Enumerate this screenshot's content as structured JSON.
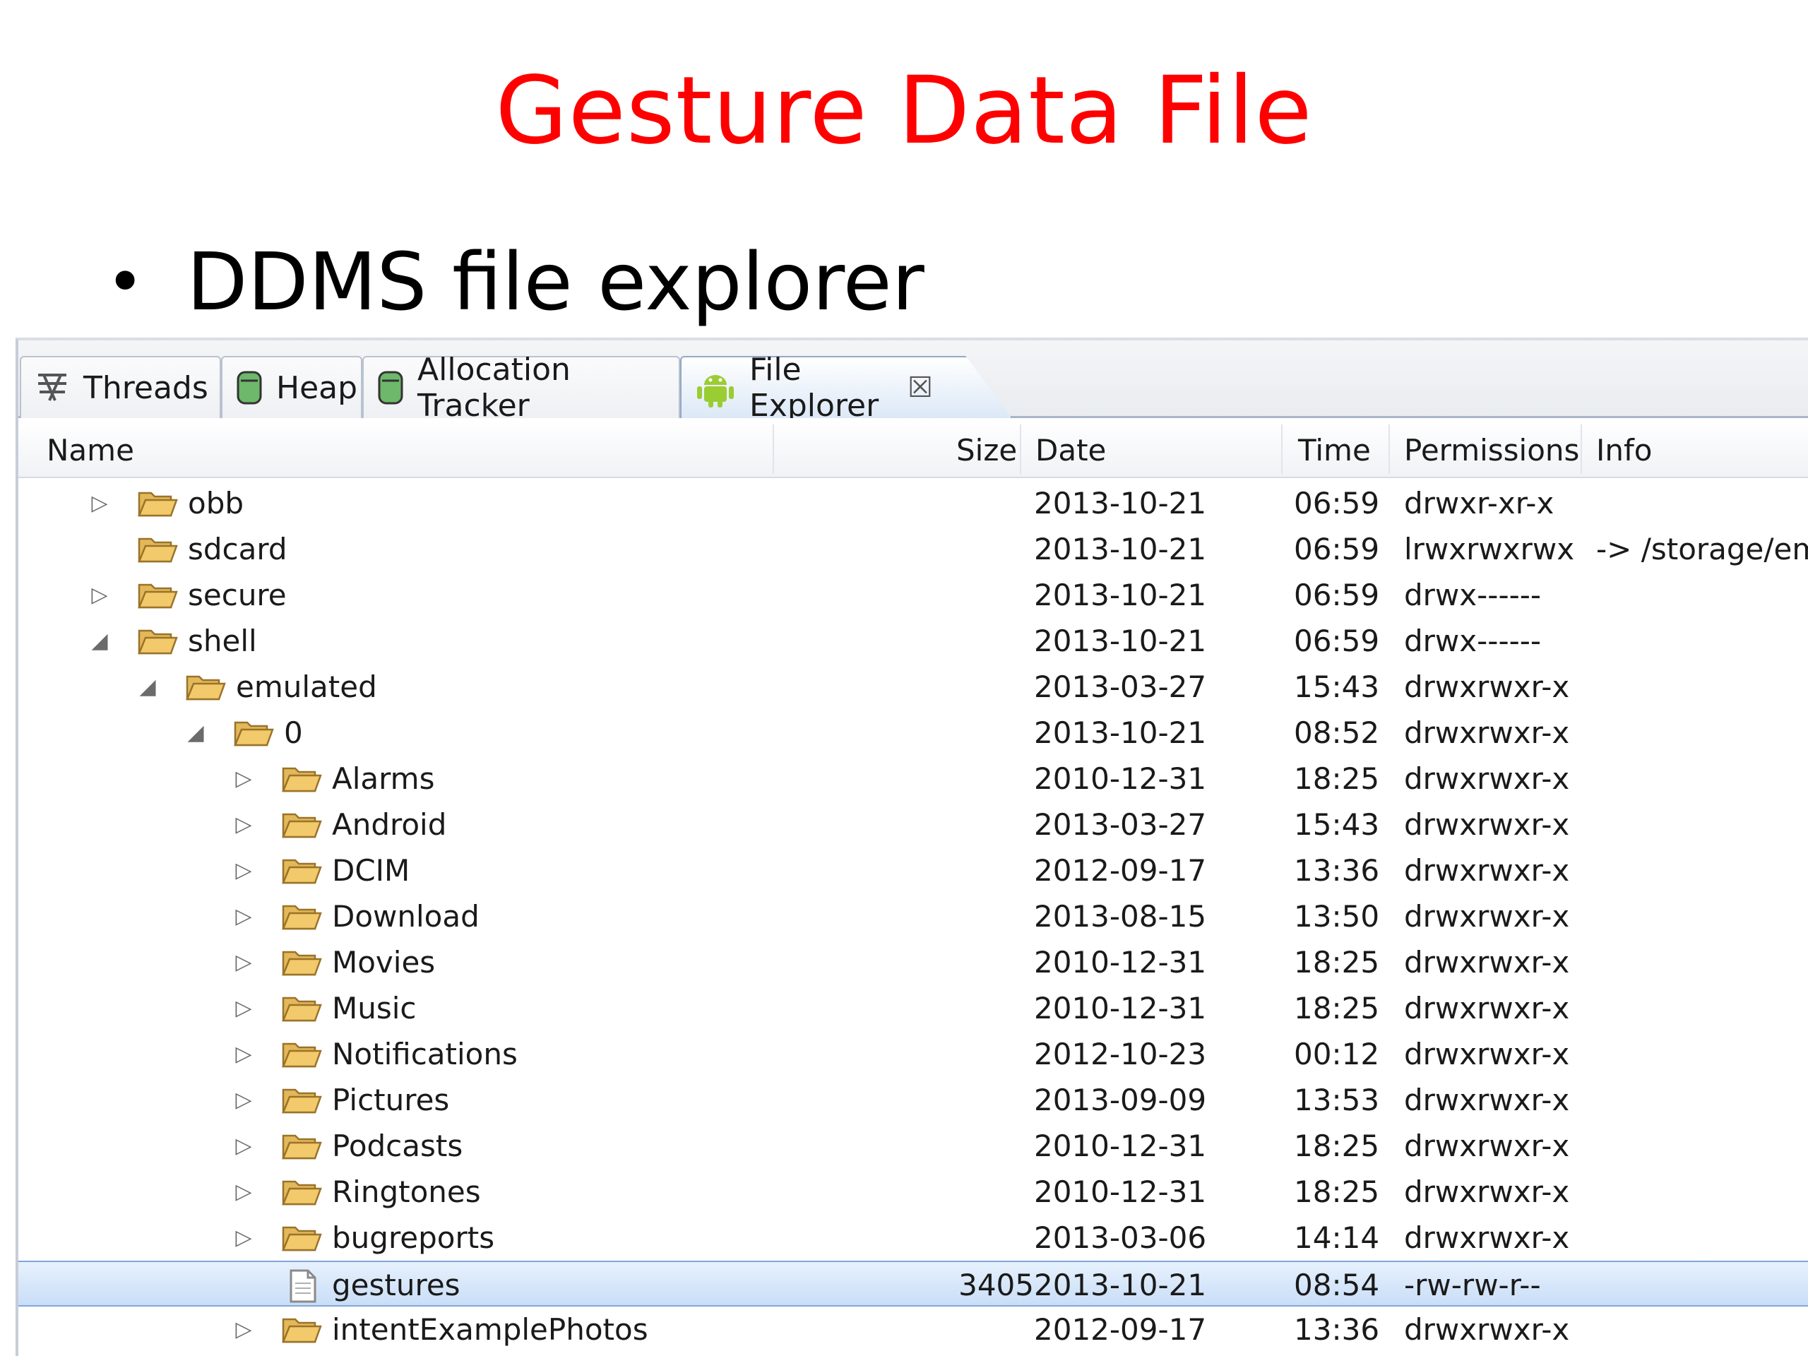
{
  "slide": {
    "title": "Gesture Data File",
    "bullet": "DDMS file explorer",
    "title_color": "#ff0000"
  },
  "tabs": [
    {
      "label": "Threads",
      "icon": "threads-icon"
    },
    {
      "label": "Heap",
      "icon": "heap-icon"
    },
    {
      "label": "Allocation Tracker",
      "icon": "allocation-icon"
    },
    {
      "label": "File Explorer",
      "icon": "android-icon",
      "active": true,
      "close": "☒"
    }
  ],
  "columns": {
    "name": "Name",
    "size": "Size",
    "date": "Date",
    "time": "Time",
    "permissions": "Permissions",
    "info": "Info"
  },
  "rows": [
    {
      "name": "obb",
      "depth": 0,
      "expander": "collapsed",
      "type": "folder",
      "size": "",
      "date": "2013-10-21",
      "time": "06:59",
      "permissions": "drwxr-xr-x",
      "info": ""
    },
    {
      "name": "sdcard",
      "depth": 0,
      "expander": "none",
      "type": "folder",
      "size": "",
      "date": "2013-10-21",
      "time": "06:59",
      "permissions": "lrwxrwxrwx",
      "info": "-> /storage/emu"
    },
    {
      "name": "secure",
      "depth": 0,
      "expander": "collapsed",
      "type": "folder",
      "size": "",
      "date": "2013-10-21",
      "time": "06:59",
      "permissions": "drwx------",
      "info": ""
    },
    {
      "name": "shell",
      "depth": 0,
      "expander": "expanded",
      "type": "folder",
      "size": "",
      "date": "2013-10-21",
      "time": "06:59",
      "permissions": "drwx------",
      "info": ""
    },
    {
      "name": "emulated",
      "depth": 1,
      "expander": "expanded",
      "type": "folder",
      "size": "",
      "date": "2013-03-27",
      "time": "15:43",
      "permissions": "drwxrwxr-x",
      "info": ""
    },
    {
      "name": "0",
      "depth": 2,
      "expander": "expanded",
      "type": "folder",
      "size": "",
      "date": "2013-10-21",
      "time": "08:52",
      "permissions": "drwxrwxr-x",
      "info": ""
    },
    {
      "name": "Alarms",
      "depth": 3,
      "expander": "collapsed",
      "type": "folder",
      "size": "",
      "date": "2010-12-31",
      "time": "18:25",
      "permissions": "drwxrwxr-x",
      "info": ""
    },
    {
      "name": "Android",
      "depth": 3,
      "expander": "collapsed",
      "type": "folder",
      "size": "",
      "date": "2013-03-27",
      "time": "15:43",
      "permissions": "drwxrwxr-x",
      "info": ""
    },
    {
      "name": "DCIM",
      "depth": 3,
      "expander": "collapsed",
      "type": "folder",
      "size": "",
      "date": "2012-09-17",
      "time": "13:36",
      "permissions": "drwxrwxr-x",
      "info": ""
    },
    {
      "name": "Download",
      "depth": 3,
      "expander": "collapsed",
      "type": "folder",
      "size": "",
      "date": "2013-08-15",
      "time": "13:50",
      "permissions": "drwxrwxr-x",
      "info": ""
    },
    {
      "name": "Movies",
      "depth": 3,
      "expander": "collapsed",
      "type": "folder",
      "size": "",
      "date": "2010-12-31",
      "time": "18:25",
      "permissions": "drwxrwxr-x",
      "info": ""
    },
    {
      "name": "Music",
      "depth": 3,
      "expander": "collapsed",
      "type": "folder",
      "size": "",
      "date": "2010-12-31",
      "time": "18:25",
      "permissions": "drwxrwxr-x",
      "info": ""
    },
    {
      "name": "Notifications",
      "depth": 3,
      "expander": "collapsed",
      "type": "folder",
      "size": "",
      "date": "2012-10-23",
      "time": "00:12",
      "permissions": "drwxrwxr-x",
      "info": ""
    },
    {
      "name": "Pictures",
      "depth": 3,
      "expander": "collapsed",
      "type": "folder",
      "size": "",
      "date": "2013-09-09",
      "time": "13:53",
      "permissions": "drwxrwxr-x",
      "info": ""
    },
    {
      "name": "Podcasts",
      "depth": 3,
      "expander": "collapsed",
      "type": "folder",
      "size": "",
      "date": "2010-12-31",
      "time": "18:25",
      "permissions": "drwxrwxr-x",
      "info": ""
    },
    {
      "name": "Ringtones",
      "depth": 3,
      "expander": "collapsed",
      "type": "folder",
      "size": "",
      "date": "2010-12-31",
      "time": "18:25",
      "permissions": "drwxrwxr-x",
      "info": ""
    },
    {
      "name": "bugreports",
      "depth": 3,
      "expander": "collapsed",
      "type": "folder",
      "size": "",
      "date": "2013-03-06",
      "time": "14:14",
      "permissions": "drwxrwxr-x",
      "info": ""
    },
    {
      "name": "gestures",
      "depth": 3,
      "expander": "none",
      "type": "file",
      "size": "3405",
      "date": "2013-10-21",
      "time": "08:54",
      "permissions": "-rw-rw-r--",
      "info": "",
      "selected": true
    },
    {
      "name": "intentExamplePhotos",
      "depth": 3,
      "expander": "collapsed",
      "type": "folder",
      "size": "",
      "date": "2012-09-17",
      "time": "13:36",
      "permissions": "drwxrwxr-x",
      "info": ""
    }
  ],
  "colors": {
    "selection": "#c9def7",
    "folder": "#f2c96b"
  }
}
